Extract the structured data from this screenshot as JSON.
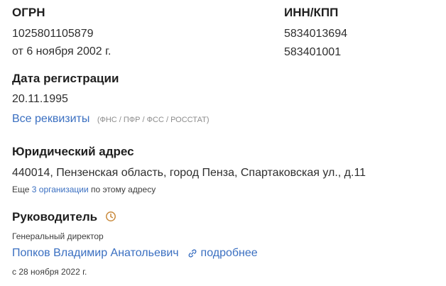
{
  "ogrn": {
    "label": "ОГРН",
    "number": "1025801105879",
    "date": "от 6 ноября 2002 г."
  },
  "inn_kpp": {
    "label": "ИНН/КПП",
    "inn": "5834013694",
    "kpp": "583401001"
  },
  "registration": {
    "label": "Дата регистрации",
    "date": "20.11.1995"
  },
  "requisites": {
    "link_label": "Все реквизиты",
    "sources": "(ФНС / ПФР / ФСС / РОССТАТ)"
  },
  "address": {
    "label": "Юридический адрес",
    "value": "440014, Пензенская область, город Пенза, Спартаковская ул., д.11",
    "more_prefix": "Еще",
    "more_link": "3 организации",
    "more_suffix": "по этому адресу"
  },
  "head": {
    "label": "Руководитель",
    "icon": "clock-icon",
    "position": "Генеральный директор",
    "name": "Попков Владимир Анатольевич",
    "details_icon": "link-icon",
    "details_label": "подробнее",
    "since": "с 28 ноября 2022 г."
  },
  "colors": {
    "link": "#3a6fc1",
    "clock": "#c98a3c"
  }
}
